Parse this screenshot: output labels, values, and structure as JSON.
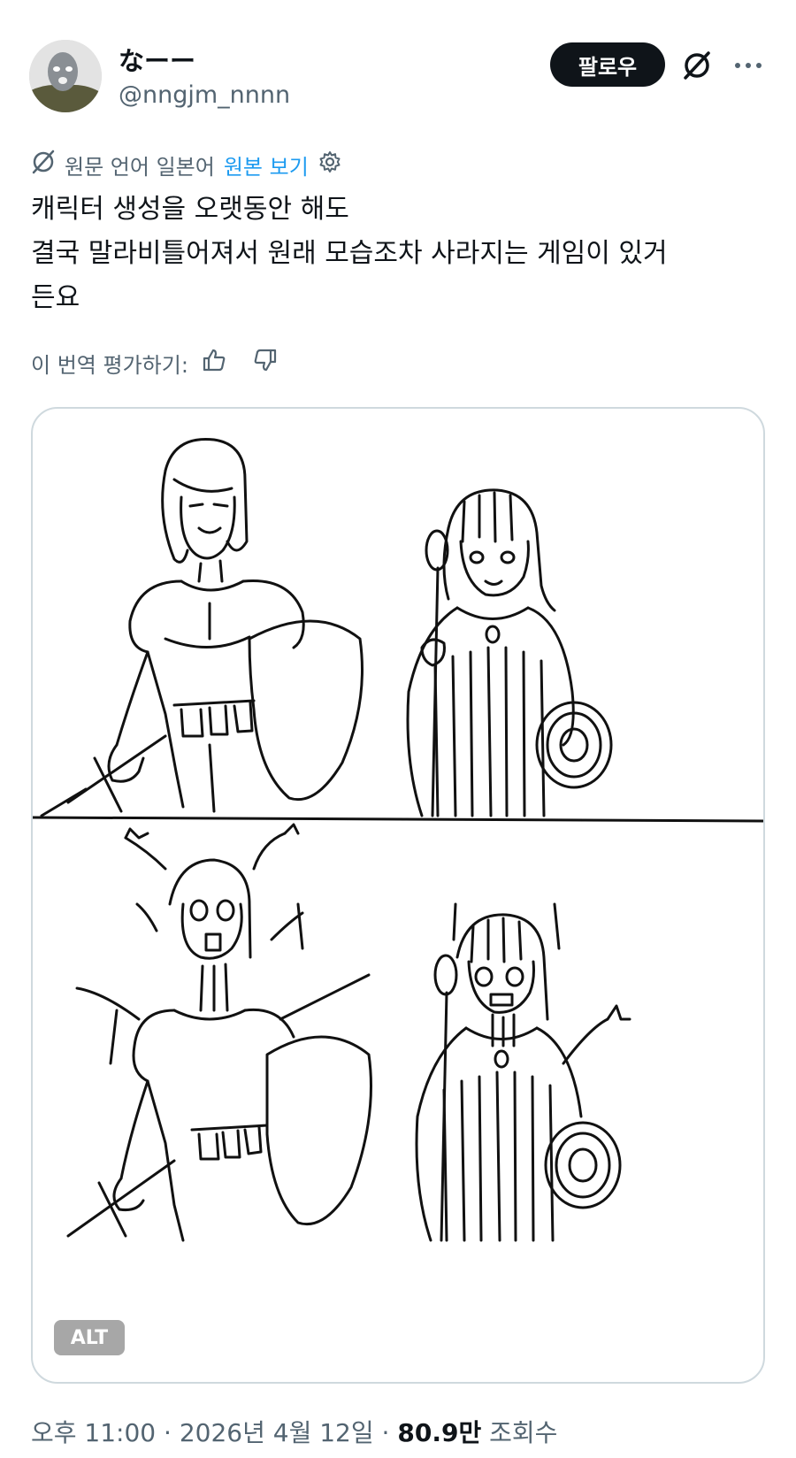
{
  "author": {
    "display_name": "なーー",
    "handle": "@nngjm_nnnn"
  },
  "actions": {
    "follow_label": "팔로우",
    "grok_icon": "grok-slash-circle-icon",
    "more_icon": "more-dots-icon"
  },
  "translation": {
    "source_note": "원문 언어 일본어",
    "view_original_label": "원본 보기",
    "settings_icon": "gear-icon"
  },
  "tweet": {
    "lines": [
      "캐릭터 생성을 오랫동안 해도",
      "결국 말라비틀어져서 원래 모습조차 사라지는 게임이 있거",
      "든요"
    ]
  },
  "rating": {
    "prompt": "이 번역 평가하기:",
    "up_icon": "thumbs-up-icon",
    "down_icon": "thumbs-down-icon"
  },
  "media": {
    "alt_badge": "ALT"
  },
  "meta": {
    "time": "오후 11:00",
    "sep1": "·",
    "date": "2026년 4월 12일",
    "sep2": "·",
    "views_count": "80.9만",
    "views_label": "조회수"
  },
  "colors": {
    "accent": "#1d9bf0",
    "text": "#0f1419",
    "secondary": "#536471",
    "border": "#cfd9de"
  }
}
